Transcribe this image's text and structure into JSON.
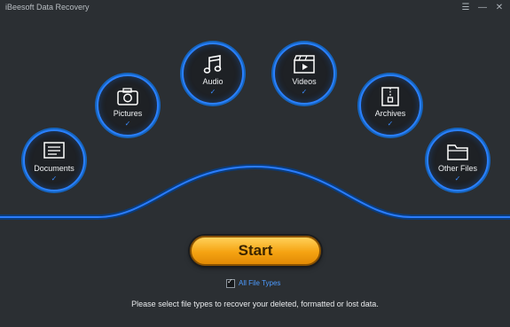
{
  "app": {
    "title": "iBeesoft Data Recovery"
  },
  "window_controls": {
    "menu": "☰",
    "minimize": "—",
    "close": "✕"
  },
  "categories": [
    {
      "label": "Documents",
      "icon": "document-icon",
      "checked": true
    },
    {
      "label": "Pictures",
      "icon": "camera-icon",
      "checked": true
    },
    {
      "label": "Audio",
      "icon": "music-note-icon",
      "checked": true
    },
    {
      "label": "Videos",
      "icon": "video-icon",
      "checked": true
    },
    {
      "label": "Archives",
      "icon": "archive-icon",
      "checked": true
    },
    {
      "label": "Other Files",
      "icon": "folder-icon",
      "checked": true
    }
  ],
  "check_glyph": "✓",
  "start_label": "Start",
  "all_file_types": {
    "label": "All File Types",
    "checked": true
  },
  "hint": "Please select file types to recover your deleted, formatted or lost data.",
  "colors": {
    "accent": "#2a80ff",
    "background": "#2b2f33",
    "start": "#f5a312"
  }
}
